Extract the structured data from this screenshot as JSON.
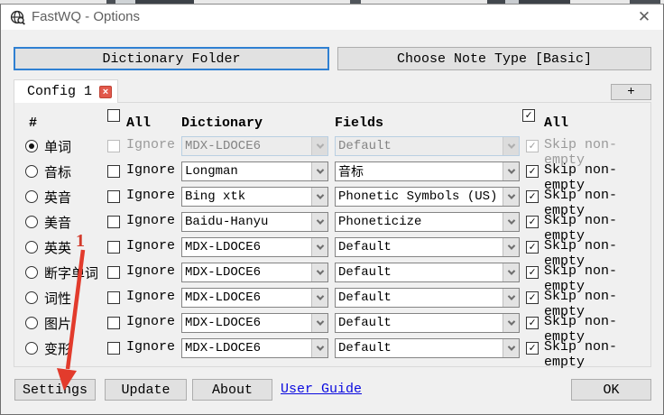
{
  "window": {
    "title": "FastWQ - Options"
  },
  "actions": {
    "dictionary_folder": "Dictionary Folder",
    "choose_note_type": "Choose Note Type [Basic]"
  },
  "tabbar": {
    "active_tab": "Config 1",
    "add_tab": "+"
  },
  "table": {
    "header": {
      "number": "#",
      "all_left": "All",
      "dictionary": "Dictionary",
      "fields": "Fields",
      "all_right": "All"
    },
    "all_left_checked": false,
    "all_right_checked": true,
    "ignore_label": "Ignore",
    "skip_label": "Skip non-empty",
    "rows": [
      {
        "label": "单词",
        "selected": true,
        "disabled": true,
        "ignore_checked": false,
        "dictionary": "MDX-LDOCE6",
        "field": "Default",
        "skip_checked": true
      },
      {
        "label": "音标",
        "selected": false,
        "disabled": false,
        "ignore_checked": false,
        "dictionary": "Longman",
        "field": "音标",
        "skip_checked": true
      },
      {
        "label": "英音",
        "selected": false,
        "disabled": false,
        "ignore_checked": false,
        "dictionary": "Bing xtk",
        "field": "Phonetic Symbols (US)",
        "skip_checked": true
      },
      {
        "label": "美音",
        "selected": false,
        "disabled": false,
        "ignore_checked": false,
        "dictionary": "Baidu-Hanyu",
        "field": "Phoneticize",
        "skip_checked": true
      },
      {
        "label": "英英",
        "selected": false,
        "disabled": false,
        "ignore_checked": false,
        "dictionary": "MDX-LDOCE6",
        "field": "Default",
        "skip_checked": true
      },
      {
        "label": "断字单词",
        "selected": false,
        "disabled": false,
        "ignore_checked": false,
        "dictionary": "MDX-LDOCE6",
        "field": "Default",
        "skip_checked": true
      },
      {
        "label": "词性",
        "selected": false,
        "disabled": false,
        "ignore_checked": false,
        "dictionary": "MDX-LDOCE6",
        "field": "Default",
        "skip_checked": true
      },
      {
        "label": "图片",
        "selected": false,
        "disabled": false,
        "ignore_checked": false,
        "dictionary": "MDX-LDOCE6",
        "field": "Default",
        "skip_checked": true
      },
      {
        "label": "变形",
        "selected": false,
        "disabled": false,
        "ignore_checked": false,
        "dictionary": "MDX-LDOCE6",
        "field": "Default",
        "skip_checked": true
      }
    ]
  },
  "footer": {
    "settings": "Settings",
    "update": "Update",
    "about": "About",
    "user_guide": "User Guide",
    "ok": "OK"
  },
  "annotation": {
    "step": "1",
    "color": "#d23a2b"
  },
  "colors": {
    "focus_border": "#2f80d2",
    "link": "#0a0adf",
    "tab_close_bg": "#e2584b"
  }
}
